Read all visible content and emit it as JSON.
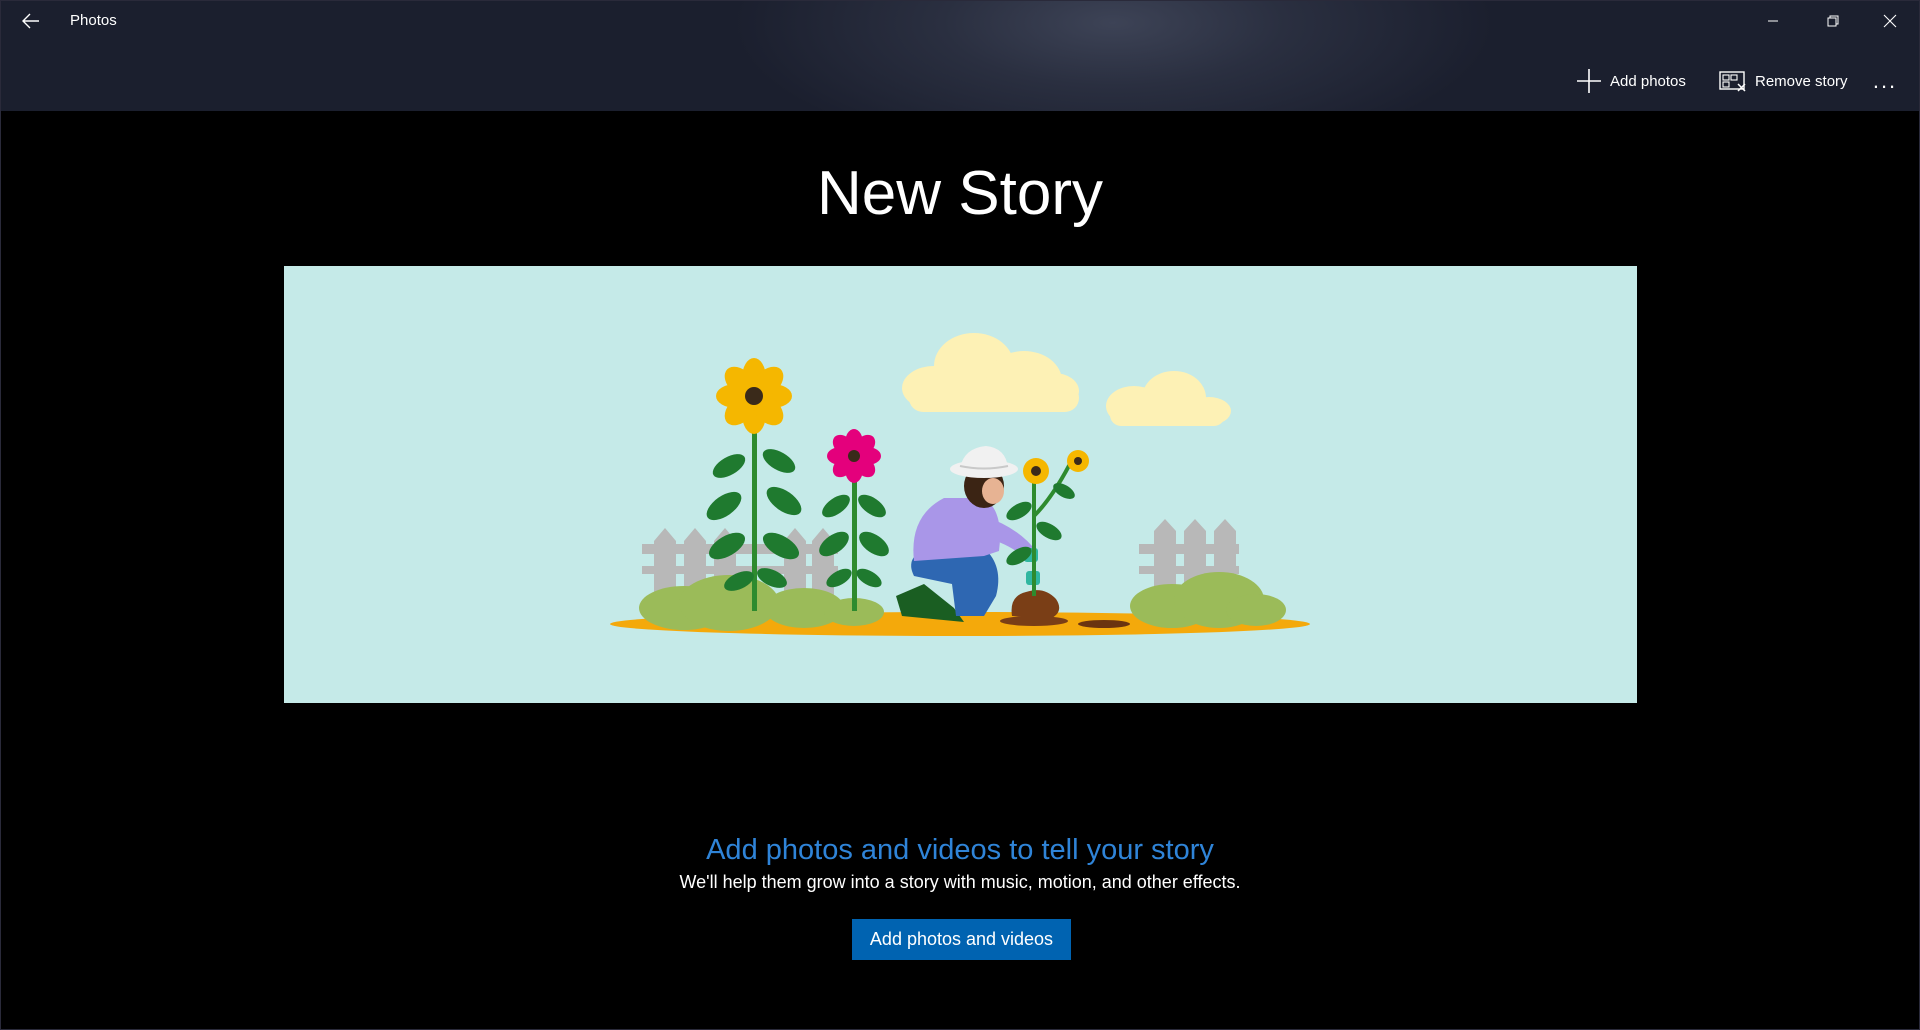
{
  "window": {
    "title": "Photos",
    "back_icon": "back-arrow-icon",
    "controls": {
      "minimize_icon": "minimize-icon",
      "restore_icon": "restore-icon",
      "close_icon": "close-icon"
    }
  },
  "toolbar": {
    "add_photos_label": "Add photos",
    "add_photos_icon": "plus-icon",
    "remove_story_label": "Remove story",
    "remove_story_icon": "remove-story-icon",
    "more_icon": "more-options-icon",
    "more_label": "..."
  },
  "main": {
    "title": "New Story",
    "illustration": "gardener-planting-flowers-illustration",
    "prompt_heading": "Add photos and videos to tell your story",
    "prompt_text": "We'll help them grow into a story with music, motion, and other effects.",
    "add_button_label": "Add photos and videos"
  },
  "colors": {
    "accent_button": "#0063b1",
    "heading_blue": "#2f84d8",
    "hero_background": "#c5eae8"
  }
}
